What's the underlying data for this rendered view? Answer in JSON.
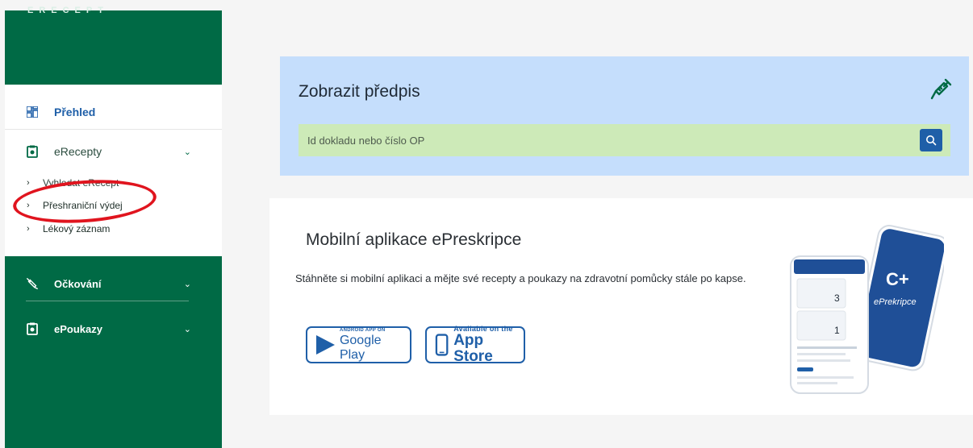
{
  "sidebar": {
    "brand": "ERECEPT",
    "prehled_label": "Přehled",
    "erecepty_label": "eRecepty",
    "erecepty_sub": [
      "Vyhledat eRecept",
      "Přeshraniční výdej",
      "Lékový záznam"
    ],
    "ockovani_label": "Očkování",
    "epoukazy_label": "ePoukazy"
  },
  "search": {
    "title": "Zobrazit předpis",
    "placeholder": "Id dokladu nebo číslo OP"
  },
  "app": {
    "title": "Mobilní aplikace ePreskripce",
    "description": "Stáhněte si mobilní aplikaci a mějte své recepty a poukazy na zdravotní pomůcky stále po kapse.",
    "google_small": "ANDROID APP ON",
    "google_big": "Google Play",
    "apple_small": "Available on the",
    "apple_big": "App Store",
    "phone_brand": "ePrekripce"
  },
  "colors": {
    "brand_green": "#006a45",
    "accent_blue": "#1f5fa8",
    "search_bg": "#c5defc",
    "input_bg": "#cdeab8",
    "annotation_red": "#e0141e"
  }
}
